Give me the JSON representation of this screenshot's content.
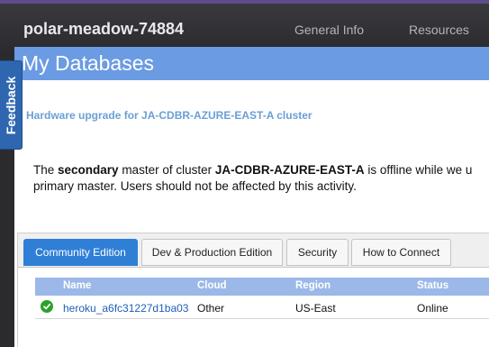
{
  "header": {
    "app_name": "polar-meadow-74884",
    "nav": [
      {
        "label": "General Info"
      },
      {
        "label": "Resources"
      }
    ]
  },
  "page": {
    "title": "My Databases"
  },
  "notice": {
    "heading": "Hardware upgrade for JA-CDBR-AZURE-EAST-A cluster",
    "body_prefix": "The ",
    "body_bold1": "secondary",
    "body_mid": " master of cluster ",
    "body_bold2": "JA-CDBR-AZURE-EAST-A",
    "body_suffix": " is offline while we u",
    "body_line2": "primary master. Users should not be affected by this activity."
  },
  "tabs": [
    {
      "label": "Community Edition",
      "active": true
    },
    {
      "label": "Dev & Production Edition",
      "active": false
    },
    {
      "label": "Security",
      "active": false
    },
    {
      "label": "How to Connect",
      "active": false
    }
  ],
  "table": {
    "columns": [
      "Name",
      "Cloud",
      "Region",
      "Status"
    ],
    "rows": [
      {
        "name": "heroku_a6fc31227d1ba03",
        "cloud": "Other",
        "region": "US-East",
        "status": "Online",
        "status_icon": "check-circle-icon"
      }
    ]
  },
  "feedback": {
    "label": "Feedback"
  },
  "colors": {
    "title_bar": "#6a9be3",
    "active_tab": "#2f7fd6",
    "table_header": "#9bb8e8",
    "status_online": "#2aa22a",
    "feedback_tab": "#2e67b0"
  }
}
